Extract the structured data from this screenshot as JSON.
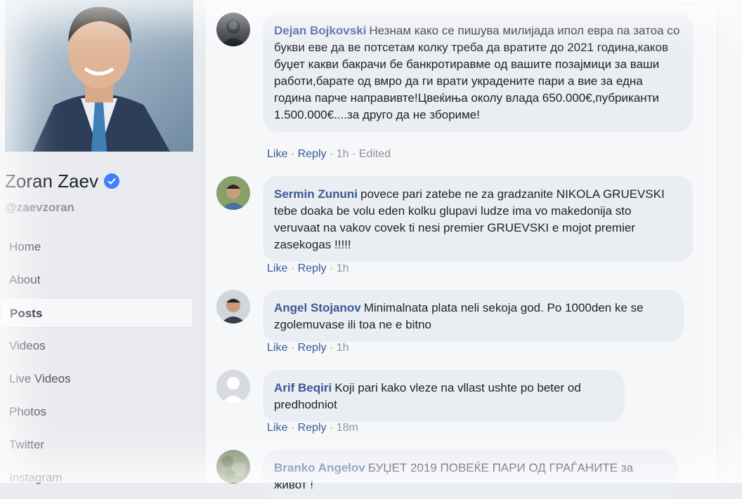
{
  "page": {
    "name": "Zoran Zaev",
    "handle": "@zaevzoran",
    "nav": [
      {
        "label": "Home"
      },
      {
        "label": "About"
      },
      {
        "label": "Posts"
      },
      {
        "label": "Videos"
      },
      {
        "label": "Live Videos"
      },
      {
        "label": "Photos"
      },
      {
        "label": "Twitter"
      },
      {
        "label": "Instagram"
      }
    ],
    "active_nav": "Posts"
  },
  "comment_actions": {
    "like": "Like",
    "reply": "Reply",
    "sep": "·"
  },
  "comments": [
    {
      "author": "Dejan Bojkovski",
      "text": "Незнам како се пишува милијада ипол евра па затоа со букви еве да ве потсетам колку треба да вратите до 2021 година,каков буџет какви бакрачи бе банкротиравме од вашите позајмици за ваши работи,барате од вмро да ги врати украдените пари а вие за една година парче направивте!Цвеќиња околу влада 650.000€,пубриканти 1.500.000€....за друго да не збориме!",
      "time": "1h",
      "edited": "Edited"
    },
    {
      "author": "Sermin Zununi",
      "text": "povece pari zatebe ne za gradzanite NIKOLA GRUEVSKI tebe doaka be volu eden kolku glupavi ludze ima vo makedonija sto veruvaat na vakov covek ti nesi premier GRUEVSKI e mojot premier zasekogas !!!!!",
      "time": "1h"
    },
    {
      "author": "Angel Stojanov",
      "text": "Minimalnata plata neli sekoja god. Po 1000den ke se zgolemuvase ili toa ne e bitno",
      "time": "1h"
    },
    {
      "author": "Arif Beqiri",
      "text": "Koji pari kako vleze na vllast ushte po beter od predhodniot",
      "time": "18m"
    },
    {
      "author": "Branko Angelov",
      "text": "БУЏЕТ 2019 ПОВЕЌЕ ПАРИ ОД ГРАЃАНИТЕ за живот !"
    }
  ],
  "colors": {
    "link": "#385898",
    "bubble": "#eaedf2",
    "verified": "#4080ff",
    "meta": "#90949c"
  },
  "icons": {
    "verified": "verified-badge-icon"
  }
}
